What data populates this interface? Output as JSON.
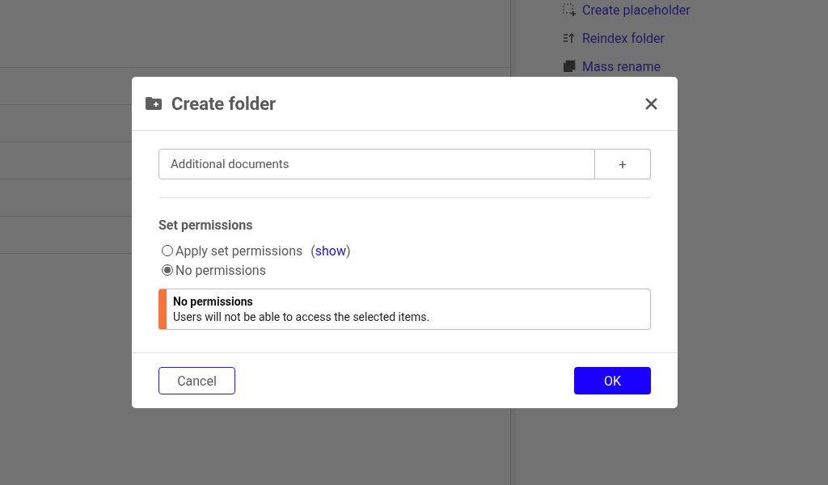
{
  "background_actions": [
    {
      "label": "Create placeholder",
      "kind": "placeholder"
    },
    {
      "label": "Reindex folder",
      "kind": "reindex"
    },
    {
      "label": "Mass rename",
      "kind": "rename"
    }
  ],
  "dialog": {
    "title": "Create folder",
    "folder_name": {
      "value": "Additional documents",
      "add_button": "+"
    },
    "permissions": {
      "heading": "Set permissions",
      "options": [
        {
          "label": "Apply set permissions",
          "link_prefix": "(",
          "link": "show",
          "link_suffix": ")",
          "selected": false
        },
        {
          "label": "No permissions",
          "selected": true
        }
      ],
      "alert": {
        "title": "No permissions",
        "message": "Users will not be able to access the selected items."
      }
    },
    "buttons": {
      "cancel": "Cancel",
      "ok": "OK"
    }
  }
}
